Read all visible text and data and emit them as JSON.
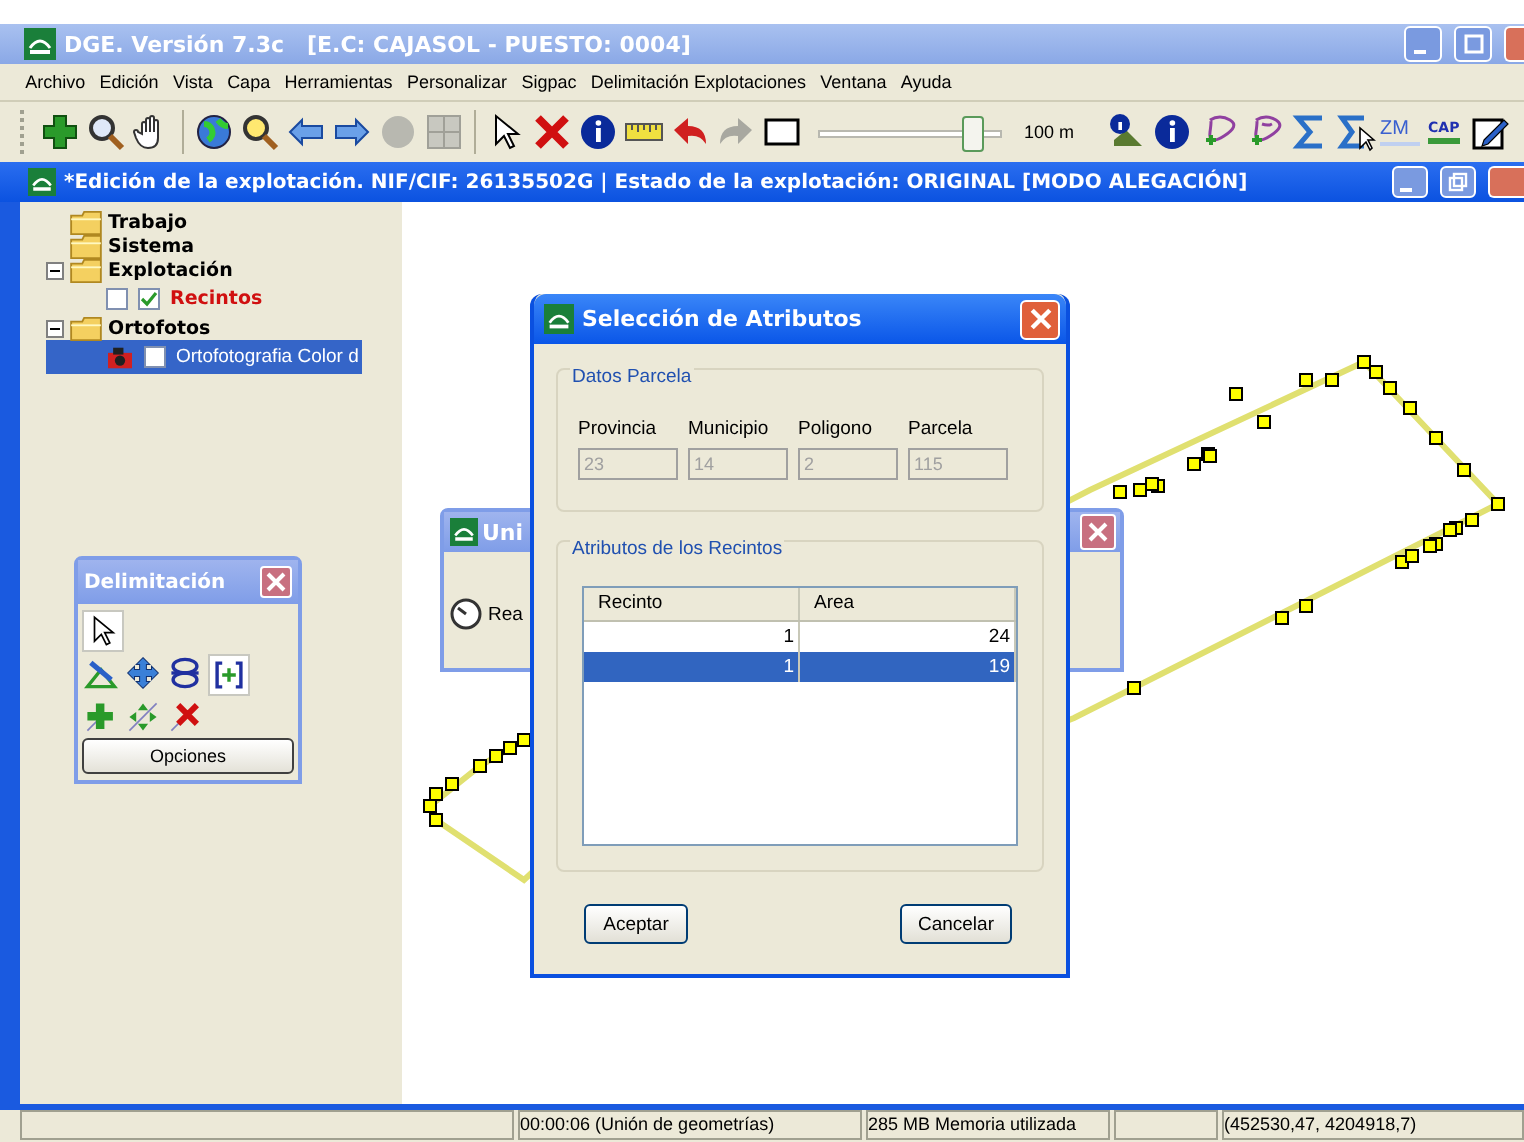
{
  "window": {
    "title": "DGE. Versión 7.3c   [E.C: CAJASOL - PUESTO: 0004]"
  },
  "menu": [
    "Archivo",
    "Edición",
    "Vista",
    "Capa",
    "Herramientas",
    "Personalizar",
    "Sigpac",
    "Delimitación Explotaciones",
    "Ventana",
    "Ayuda"
  ],
  "toolbar": {
    "scale": {
      "level": 0.84,
      "reading": "100 m"
    },
    "zoom_icon_label": "ZM",
    "cap_icon_label": "CAP"
  },
  "document": {
    "title": "*Edición de la explotación. NIF/CIF: 26135502G | Estado de la explotación: ORIGINAL [MODO ALEGACIÓN]"
  },
  "layers": [
    {
      "label": "Trabajo"
    },
    {
      "label": "Sistema"
    },
    {
      "label": "Explotación",
      "expanded": true,
      "children": [
        {
          "label": "Recintos",
          "kind": "vector",
          "checks": [
            false,
            true
          ],
          "selected": false
        }
      ]
    },
    {
      "label": "Ortofotos",
      "expanded": true,
      "children": [
        {
          "label": "Ortofotografia Color d",
          "kind": "raster",
          "checks": [
            false
          ],
          "selected": true
        }
      ]
    }
  ],
  "palette": {
    "title": "Delimitación",
    "button": "Opciones"
  },
  "progress_window": {
    "title": "Uni",
    "message": "Rea"
  },
  "dialog": {
    "title": "Selección de Atributos",
    "parcel_group": "Datos Parcela",
    "fields": [
      {
        "label": "Provincia",
        "value": "23",
        "disabled": true
      },
      {
        "label": "Municipio",
        "value": "14",
        "disabled": true
      },
      {
        "label": "Poligono",
        "value": "2",
        "disabled": true
      },
      {
        "label": "Parcela",
        "value": "115",
        "disabled": true
      }
    ],
    "recintos_group": "Atributos de los Recintos",
    "table": {
      "columns": [
        "Recinto",
        "Area"
      ],
      "rows": [
        {
          "cells": [
            "1",
            "24"
          ],
          "selected": false
        },
        {
          "cells": [
            "1",
            "19"
          ],
          "selected": true
        }
      ]
    },
    "buttons": [
      "Aceptar",
      "Cancelar"
    ]
  },
  "status_bar": [
    "00:00:06 (Unión de geometrías)",
    "285 MB Memoria utilizada",
    "(452530,47, 4204918,7)"
  ]
}
